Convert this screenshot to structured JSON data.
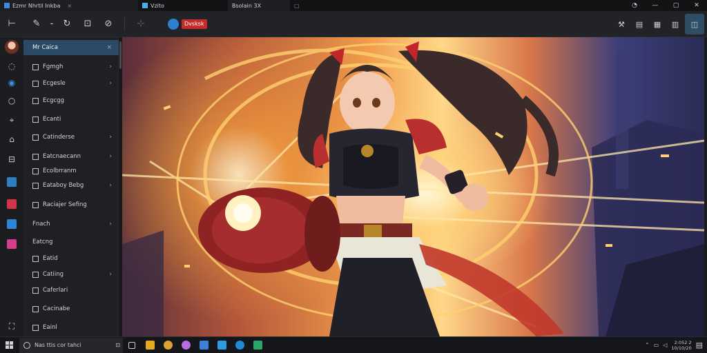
{
  "titlebar": {
    "tab1": "Ezmr Nhrtil Inkba",
    "tab2": "Vzito",
    "tab3": "Bsolain 3X",
    "controls": [
      "help-icon",
      "minimize-icon",
      "maximize-icon",
      "close-icon"
    ]
  },
  "toolbar": {
    "badge": "Dvsksk"
  },
  "menu": {
    "items": [
      {
        "label": "Mr Caica",
        "arrow": "×",
        "selected": true
      },
      {
        "label": "Fgmgh",
        "arrow": "›"
      },
      {
        "label": "Ecgesle",
        "arrow": "›"
      },
      {
        "label": "Ecgcgg",
        "arrow": ""
      },
      {
        "label": "Ecanti",
        "arrow": ""
      },
      {
        "label": "Catinderse",
        "arrow": "›"
      },
      {
        "label": "Eatcnaecann",
        "arrow": "›"
      },
      {
        "label": "Ecolbrranm",
        "arrow": ""
      },
      {
        "label": "Eataboy Bebg",
        "arrow": "›"
      },
      {
        "label": "Raciajer Sefing",
        "arrow": ""
      },
      {
        "label": "Fnach",
        "arrow": "›"
      },
      {
        "label": "Eatcng",
        "arrow": ""
      },
      {
        "label": "Eatid",
        "arrow": ""
      },
      {
        "label": "Catiing",
        "arrow": "›"
      },
      {
        "label": "Caferlari",
        "arrow": ""
      },
      {
        "label": "Cacinabe",
        "arrow": ""
      },
      {
        "label": "Eainl",
        "arrow": ""
      }
    ]
  },
  "taskbar": {
    "search_text": "Nas ttis cor tahci",
    "time": "2:052 2",
    "date": "10/10/20"
  },
  "colors": {
    "selection": "#2a4a66",
    "badge": "#c42b2b",
    "accent": "#2f7fd1"
  }
}
